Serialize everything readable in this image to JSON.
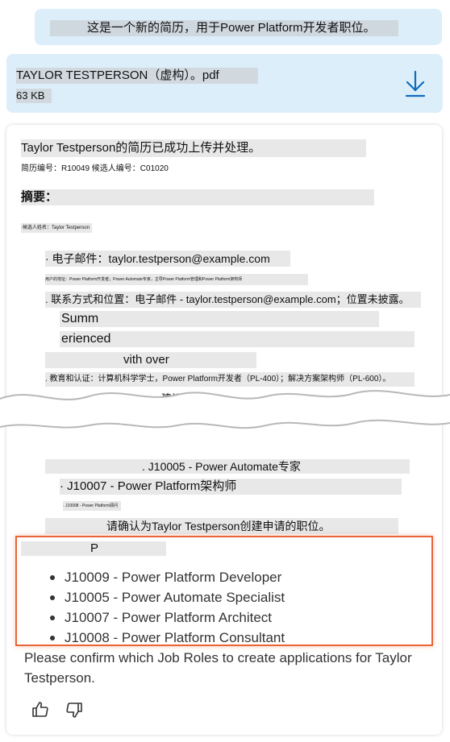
{
  "user_message": "这是一个新的简历，用于Power Platform开发者职位。",
  "attachment": {
    "file_name": "TAYLOR TESTPERSON（虚构）。pdf",
    "file_size": "63 KB",
    "download_icon": "download-icon"
  },
  "reply": {
    "headline": "Taylor Testperson的简历已成功上传并处理。",
    "ids_line": "简历编号：R10049 候选人编号：C01020",
    "summary_heading": "摘要：",
    "tiny_line_1": "·候选人姓名：Taylor Testperson",
    "email_line": "· 电子邮件：taylor.testperson@example.com",
    "tiny_line_2": "用户的地址：Power Platform开发者；Power Automate专家，主导Power Platform管理和Power Platform架构师",
    "contact_line": ". 联系方式和位置：电子邮件 - taylor.testperson@example.com；位置未披露。",
    "frag_summ": "Summ",
    "frag_erienced": "erienced",
    "frag_vith_over": "vith over",
    "edu_line": ". 教育和认证：计算机科学学士，Power Platform开发者（PL-400）；解决方案架构师（PL-600）。",
    "suggest_line": "建议的职位：",
    "role_line_a": ". J10005 - Power Automate专家",
    "role_line_b": "· J10007 - Power Platform架构师",
    "tiny_line_3": "· J10008 - Power Platform顾问",
    "confirm_cn": "请确认为Taylor Testperson创建申请的职位。",
    "frag_p": "P",
    "roles": [
      "J10009 - Power Platform Developer",
      "J10005 - Power Automate Specialist",
      "J10007 - Power Platform Architect",
      "J10008 - Power Platform Consultant"
    ],
    "confirm_en": "Please confirm which Job Roles to create applications for Taylor Testperson.",
    "thumbs_up_icon": "thumbs-up-icon",
    "thumbs_down_icon": "thumbs-down-icon"
  },
  "colors": {
    "bubble": "#dceefa",
    "accent": "#0f6cbd",
    "highlight": "#e8653a"
  }
}
